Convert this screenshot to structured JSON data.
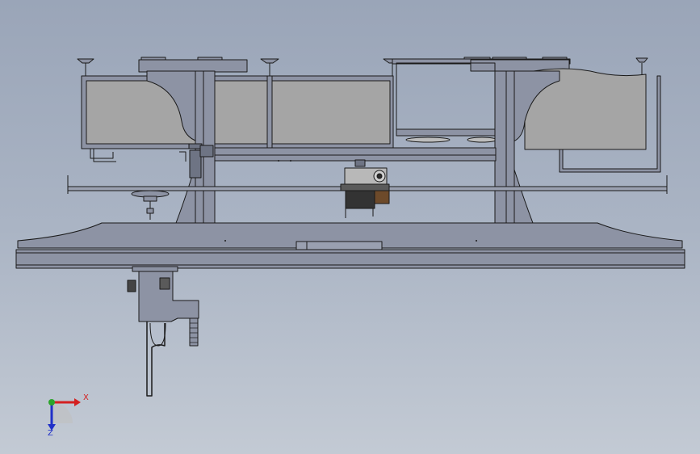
{
  "view": {
    "background_top": "#9aa5b8",
    "background_bottom": "#c3cad4",
    "part_fill": "#8d93a4",
    "panel_fill": "#a5a5a5",
    "line_color": "#1a1a1a"
  },
  "triad": {
    "x_label": "X",
    "z_label": "Z",
    "x_color": "#d42020",
    "y_color": "#2aa52a",
    "z_color": "#2030c8"
  }
}
